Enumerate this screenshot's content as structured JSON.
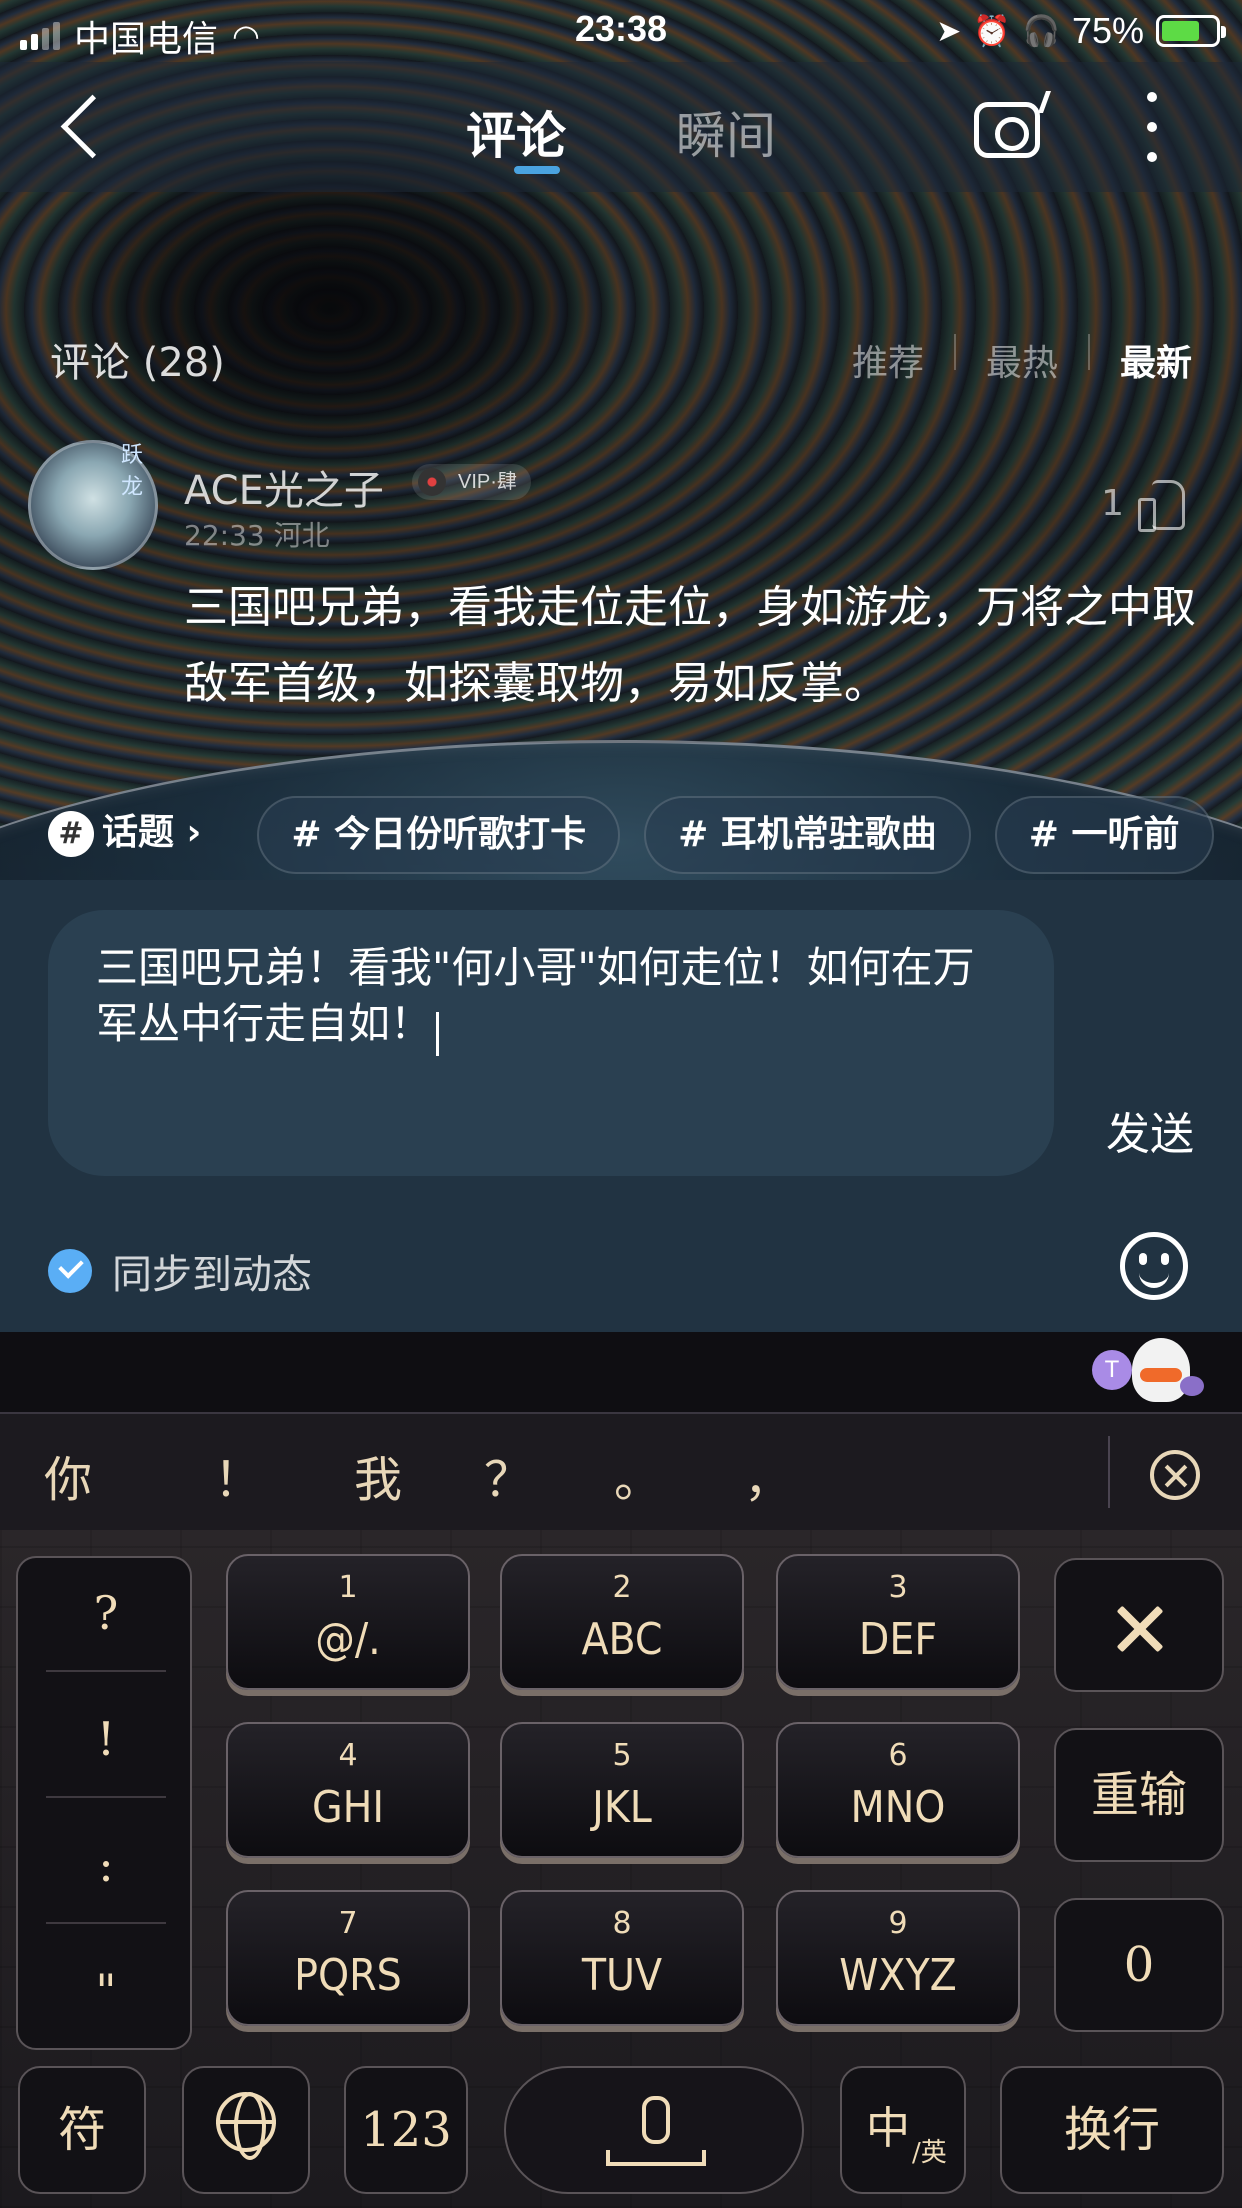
{
  "status_bar": {
    "carrier": "中国电信",
    "time": "23:38",
    "battery_pct": "75%",
    "battery_color": "#5ddb45"
  },
  "nav": {
    "tabs": [
      {
        "label": "评论",
        "active": true
      },
      {
        "label": "瞬间",
        "active": false
      }
    ],
    "accent_color": "#4aa3e0",
    "icons": [
      "back-icon",
      "camera-icon",
      "more-icon"
    ]
  },
  "comments": {
    "section_title": "评论 (28)",
    "sort_options": [
      "推荐",
      "最热",
      "最新"
    ],
    "active_sort": "最新",
    "items": [
      {
        "username": "ACE光之子",
        "vip": "VIP·肆",
        "avatar_text": "跃龙",
        "time_location": "22:33 河北",
        "likes": "1",
        "text": "三国吧兄弟，看我走位走位，身如游龙，万将之中取敌军首级，如探囊取物，易如反掌。"
      }
    ]
  },
  "topics": {
    "label": "话题",
    "chips": [
      "# 今日份听歌打卡",
      "# 耳机常驻歌曲",
      "# 一听前"
    ]
  },
  "composer": {
    "input_value": "三国吧兄弟！看我\"何小哥\"如何走位！如何在万军丛中行走自如！",
    "send_label": "发送",
    "sync_label": "同步到动态",
    "sync_checked": true,
    "check_color": "#5aaef5"
  },
  "keyboard": {
    "candidates": [
      "你",
      "！",
      "我",
      "？",
      "。",
      "，"
    ],
    "punctuation": [
      "?",
      "!",
      ":",
      "\""
    ],
    "keys": [
      {
        "num": "1",
        "letters": "@/."
      },
      {
        "num": "2",
        "letters": "ABC"
      },
      {
        "num": "3",
        "letters": "DEF"
      },
      {
        "num": "4",
        "letters": "GHI"
      },
      {
        "num": "5",
        "letters": "JKL"
      },
      {
        "num": "6",
        "letters": "MNO"
      },
      {
        "num": "7",
        "letters": "PQRS"
      },
      {
        "num": "8",
        "letters": "TUV"
      },
      {
        "num": "9",
        "letters": "WXYZ"
      }
    ],
    "reenter_label": "重输",
    "zero_label": "0",
    "symbol_label": "符",
    "num_label": "123",
    "lang_label_main": "中",
    "lang_label_sub": "/英",
    "newline_label": "换行",
    "mascot_letter": "T",
    "key_text_color": "#f0dcb8"
  }
}
